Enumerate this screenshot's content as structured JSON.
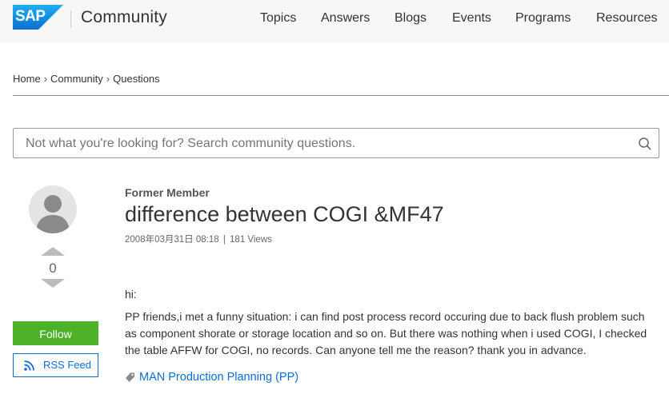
{
  "header": {
    "logo_text": "SAP",
    "site_name": "Community",
    "nav": [
      "Topics",
      "Answers",
      "Blogs",
      "Events",
      "Programs",
      "Resources"
    ]
  },
  "breadcrumb": [
    "Home",
    "Community",
    "Questions"
  ],
  "search": {
    "placeholder": "Not what you're looking for? Search community questions."
  },
  "sidebar": {
    "vote_count": "0",
    "follow_label": "Follow",
    "rss_label": "RSS Feed"
  },
  "post": {
    "author": "Former Member",
    "title": "difference between COGI &MF47",
    "date": "2008年03月31日 08:18",
    "views": "181 Views",
    "greeting": "hi:",
    "body": "PP friends,i met a funny situation: i can find post process record occuring due to back flush problem such as component shorate or storage location and so on. But there was nothing when i used COGI, I checked the table AFFW for COGI, no records. Can anyone tell me the reason? thank you in advance.",
    "tag": "MAN Production Planning (PP)"
  },
  "colors": {
    "brand": "#0a6ed1",
    "follow_button": "#4db228",
    "header_bg": "#f7f7f7"
  },
  "icons": [
    "sap-logo",
    "search-icon",
    "avatar-icon",
    "vote-up-icon",
    "vote-down-icon",
    "rss-icon",
    "tag-icon"
  ]
}
